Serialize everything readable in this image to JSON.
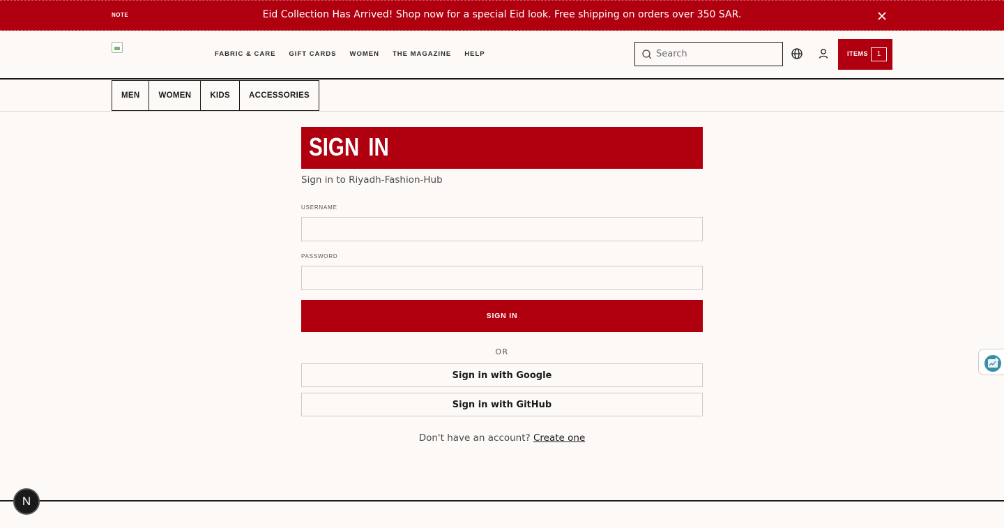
{
  "announcement": {
    "note_label": "NOTE",
    "message": "Eid Collection Has Arrived! Shop now for a special Eid look. Free shipping on orders over 350 SAR.",
    "close_icon": "close-icon"
  },
  "header": {
    "nav": [
      "Fabric & Care",
      "Gift Cards",
      "Women",
      "The Magazine",
      "Help"
    ],
    "search": {
      "placeholder": "Search",
      "value": ""
    },
    "cart": {
      "label": "ITEMS",
      "count": "1"
    }
  },
  "categories": [
    "Men",
    "Women",
    "Kids",
    "Accessories"
  ],
  "signin": {
    "title": "SIGN IN",
    "subtitle": "Sign in to Riyadh-Fashion-Hub",
    "username_label": "USERNAME",
    "username_value": "",
    "password_label": "PASSWORD",
    "password_value": "",
    "submit_label": "SIGN IN",
    "or_label": "OR",
    "google_label": "Sign in with Google",
    "github_label": "Sign in with GitHub",
    "no_account_text": "Don't have an account?",
    "create_link": "Create one"
  },
  "badge": {
    "letter": "N"
  },
  "colors": {
    "brand": "#b0000f",
    "background": "#fdf9f6",
    "text": "#1a1a1a"
  }
}
